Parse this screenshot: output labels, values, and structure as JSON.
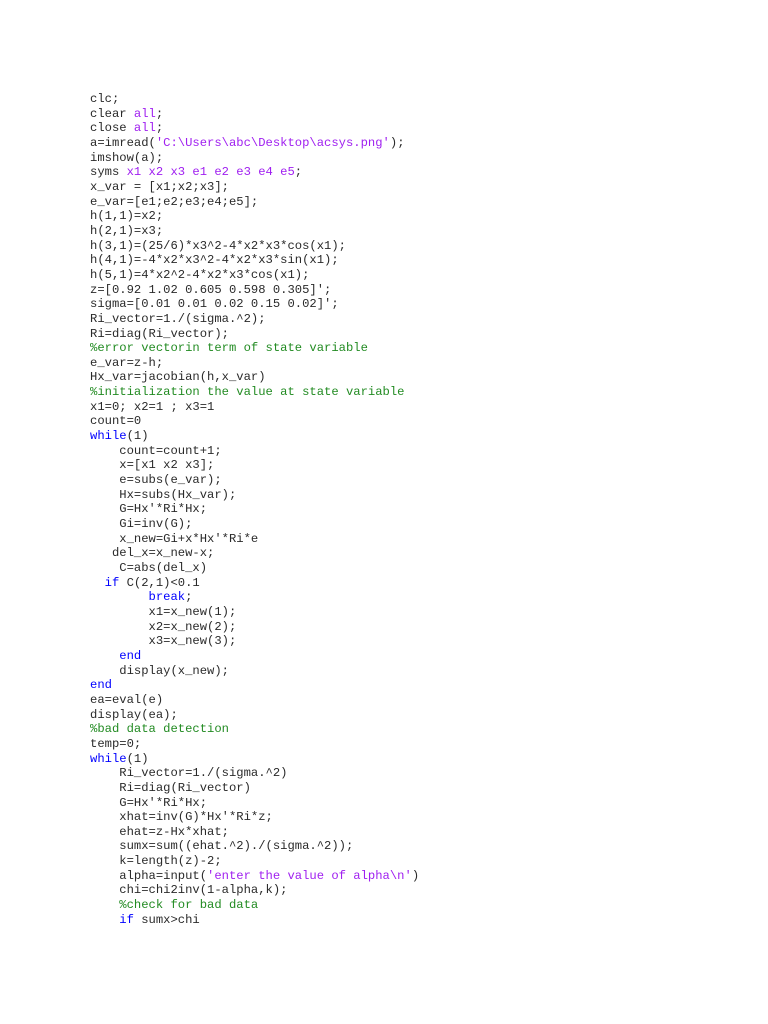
{
  "colors": {
    "keyword": "#0000ff",
    "string": "#a020f0",
    "comment": "#228b22",
    "text": "#2a2a2a"
  },
  "code_lines": [
    [
      [
        "t",
        "clc;"
      ]
    ],
    [
      [
        "t",
        "clear "
      ],
      [
        "str",
        "all"
      ],
      [
        "t",
        ";"
      ]
    ],
    [
      [
        "t",
        "close "
      ],
      [
        "str",
        "all"
      ],
      [
        "t",
        ";"
      ]
    ],
    [
      [
        "t",
        "a=imread("
      ],
      [
        "str",
        "'C:\\Users\\abc\\Desktop\\acsys.png'"
      ],
      [
        "t",
        ");"
      ]
    ],
    [
      [
        "t",
        "imshow(a);"
      ]
    ],
    [
      [
        "t",
        "syms "
      ],
      [
        "str",
        "x1 x2 x3 e1 e2 e3 e4 e5"
      ],
      [
        "t",
        ";"
      ]
    ],
    [
      [
        "t",
        "x_var = [x1;x2;x3];"
      ]
    ],
    [
      [
        "t",
        "e_var=[e1;e2;e3;e4;e5];"
      ]
    ],
    [
      [
        "t",
        "h(1,1)=x2;"
      ]
    ],
    [
      [
        "t",
        "h(2,1)=x3;"
      ]
    ],
    [
      [
        "t",
        "h(3,1)=(25/6)*x3^2-4*x2*x3*cos(x1);"
      ]
    ],
    [
      [
        "t",
        "h(4,1)=-4*x2*x3^2-4*x2*x3*sin(x1);"
      ]
    ],
    [
      [
        "t",
        "h(5,1)=4*x2^2-4*x2*x3*cos(x1);"
      ]
    ],
    [
      [
        "t",
        "z=[0.92 1.02 0.605 0.598 0.305]';"
      ]
    ],
    [
      [
        "t",
        "sigma=[0.01 0.01 0.02 0.15 0.02]';"
      ]
    ],
    [
      [
        "t",
        "Ri_vector=1./(sigma.^2);"
      ]
    ],
    [
      [
        "t",
        "Ri=diag(Ri_vector);"
      ]
    ],
    [
      [
        "com",
        "%error vectorin term of state variable"
      ]
    ],
    [
      [
        "t",
        "e_var=z-h;"
      ]
    ],
    [
      [
        "t",
        "Hx_var=jacobian(h,x_var)"
      ]
    ],
    [
      [
        "com",
        "%initialization the value at state variable"
      ]
    ],
    [
      [
        "t",
        "x1=0; x2=1 ; x3=1"
      ]
    ],
    [
      [
        "t",
        "count=0"
      ]
    ],
    [
      [
        "kw",
        "while"
      ],
      [
        "t",
        "(1)"
      ]
    ],
    [
      [
        "t",
        "    count=count+1;"
      ]
    ],
    [
      [
        "t",
        "    x=[x1 x2 x3];"
      ]
    ],
    [
      [
        "t",
        "    e=subs(e_var);"
      ]
    ],
    [
      [
        "t",
        "    Hx=subs(Hx_var);"
      ]
    ],
    [
      [
        "t",
        "    G=Hx'*Ri*Hx;"
      ]
    ],
    [
      [
        "t",
        "    Gi=inv(G);"
      ]
    ],
    [
      [
        "t",
        "    x_new=Gi+x*Hx'*Ri*e"
      ]
    ],
    [
      [
        "t",
        "   del_x=x_new-x;"
      ]
    ],
    [
      [
        "t",
        "    C=abs(del_x)"
      ]
    ],
    [
      [
        "t",
        "  "
      ],
      [
        "kw",
        "if"
      ],
      [
        "t",
        " C(2,1)<0.1"
      ]
    ],
    [
      [
        "t",
        "        "
      ],
      [
        "kw",
        "break"
      ],
      [
        "t",
        ";"
      ]
    ],
    [
      [
        "t",
        "        x1=x_new(1);"
      ]
    ],
    [
      [
        "t",
        "        x2=x_new(2);"
      ]
    ],
    [
      [
        "t",
        "        x3=x_new(3);"
      ]
    ],
    [
      [
        "t",
        "    "
      ],
      [
        "kw",
        "end"
      ]
    ],
    [
      [
        "t",
        "    display(x_new);"
      ]
    ],
    [
      [
        "kw",
        "end"
      ]
    ],
    [
      [
        "t",
        "ea=eval(e)"
      ]
    ],
    [
      [
        "t",
        "display(ea);"
      ]
    ],
    [
      [
        "com",
        "%bad data detection"
      ]
    ],
    [
      [
        "t",
        "temp=0;"
      ]
    ],
    [
      [
        "kw",
        "while"
      ],
      [
        "t",
        "(1)"
      ]
    ],
    [
      [
        "t",
        "    Ri_vector=1./(sigma.^2)"
      ]
    ],
    [
      [
        "t",
        "    Ri=diag(Ri_vector)"
      ]
    ],
    [
      [
        "t",
        "    G=Hx'*Ri*Hx;"
      ]
    ],
    [
      [
        "t",
        "    xhat=inv(G)*Hx'*Ri*z;"
      ]
    ],
    [
      [
        "t",
        "    ehat=z-Hx*xhat;"
      ]
    ],
    [
      [
        "t",
        "    sumx=sum((ehat.^2)./(sigma.^2));"
      ]
    ],
    [
      [
        "t",
        "    k=length(z)-2;"
      ]
    ],
    [
      [
        "t",
        "    alpha=input("
      ],
      [
        "str",
        "'enter the value of alpha\\n'"
      ],
      [
        "t",
        ")"
      ]
    ],
    [
      [
        "t",
        "    chi=chi2inv(1-alpha,k);"
      ]
    ],
    [
      [
        "t",
        "    "
      ],
      [
        "com",
        "%check for bad data"
      ]
    ],
    [
      [
        "t",
        "    "
      ],
      [
        "kw",
        "if"
      ],
      [
        "t",
        " sumx>chi"
      ]
    ]
  ]
}
